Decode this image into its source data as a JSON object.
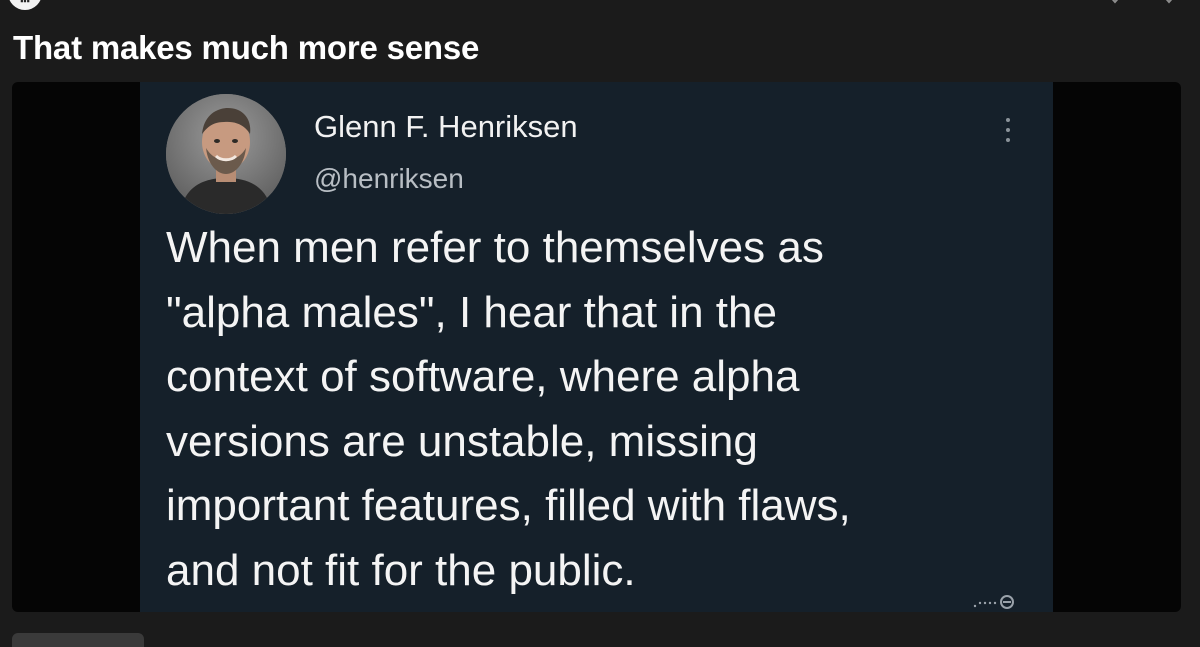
{
  "post": {
    "title": "That makes much more sense"
  },
  "tweet": {
    "author_name": "Glenn F. Henriksen",
    "author_handle": "@henriksen",
    "body_lines": [
      "When men refer to themselves as",
      "\"alpha males\", I hear that in the",
      "context of software, where alpha",
      "versions are unstable, missing",
      "important features, filled with flaws,",
      "and not fit for the public."
    ]
  },
  "colors": {
    "page_background": "#1b1b1b",
    "tweet_background": "#15202a",
    "title_text": "#ffffff",
    "handle_text": "#b8bec4"
  },
  "icons": {
    "tweet_menu": "more-vertical-icon",
    "watermark": "watermark-icon",
    "top_left": "community-avatar-icon"
  }
}
